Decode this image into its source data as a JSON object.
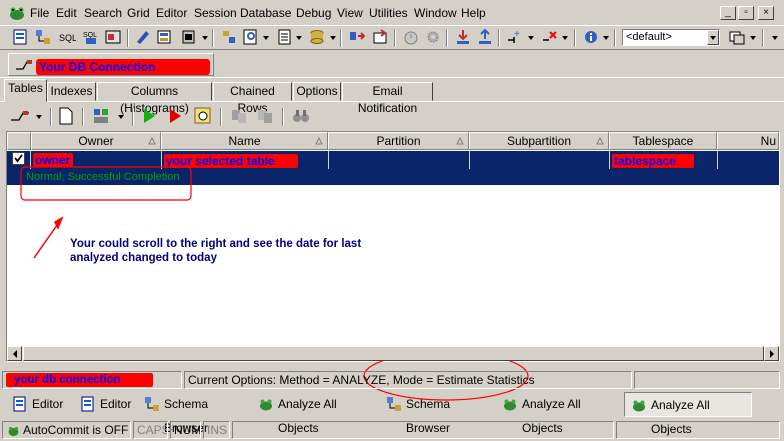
{
  "menubar": {
    "items": [
      "File",
      "Edit",
      "Search",
      "Grid",
      "Editor",
      "Session",
      "Database",
      "Debug",
      "View",
      "Utilities",
      "Window",
      "Help"
    ],
    "window_buttons": [
      "_",
      "▫",
      "×"
    ]
  },
  "toolbar": {
    "schema_combo_value": "<default>"
  },
  "connection_bar": {
    "label": "Your DB Connection"
  },
  "tabs": [
    "Tables",
    "Indexes",
    "Columns (Histograms)",
    "Chained Rows",
    "Options",
    "Email Notification"
  ],
  "grid": {
    "columns": [
      "Owner",
      "Name",
      "Partition",
      "Subpartition",
      "Tablespace",
      "Nu"
    ],
    "row": {
      "owner": "owner",
      "name": "your selected table",
      "tablespace": "tablespace"
    },
    "status_message": "Normal, Successful Completion"
  },
  "annotation": {
    "line1": "Your could scroll to the right and see the date for last",
    "line2": "analyzed changed  to today"
  },
  "status": {
    "connection": "your db connection",
    "options": "Current Options: Method = ANALYZE, Mode = Estimate Statistics"
  },
  "taskbar": [
    "Editor",
    "Editor",
    "Schema Browser",
    "Analyze All Objects",
    "Schema Browser",
    "Analyze All Objects",
    "Analyze All Objects"
  ],
  "bottombar": {
    "autocommit": "AutoCommit is OFF",
    "caps": "CAPS",
    "num": "NUM",
    "ins": "INS"
  },
  "colors": {
    "selection": "#0a246a",
    "highlight_red": "#ff0000",
    "highlight_text": "#0000ff",
    "annotation": "#000080",
    "success": "#00a000"
  }
}
